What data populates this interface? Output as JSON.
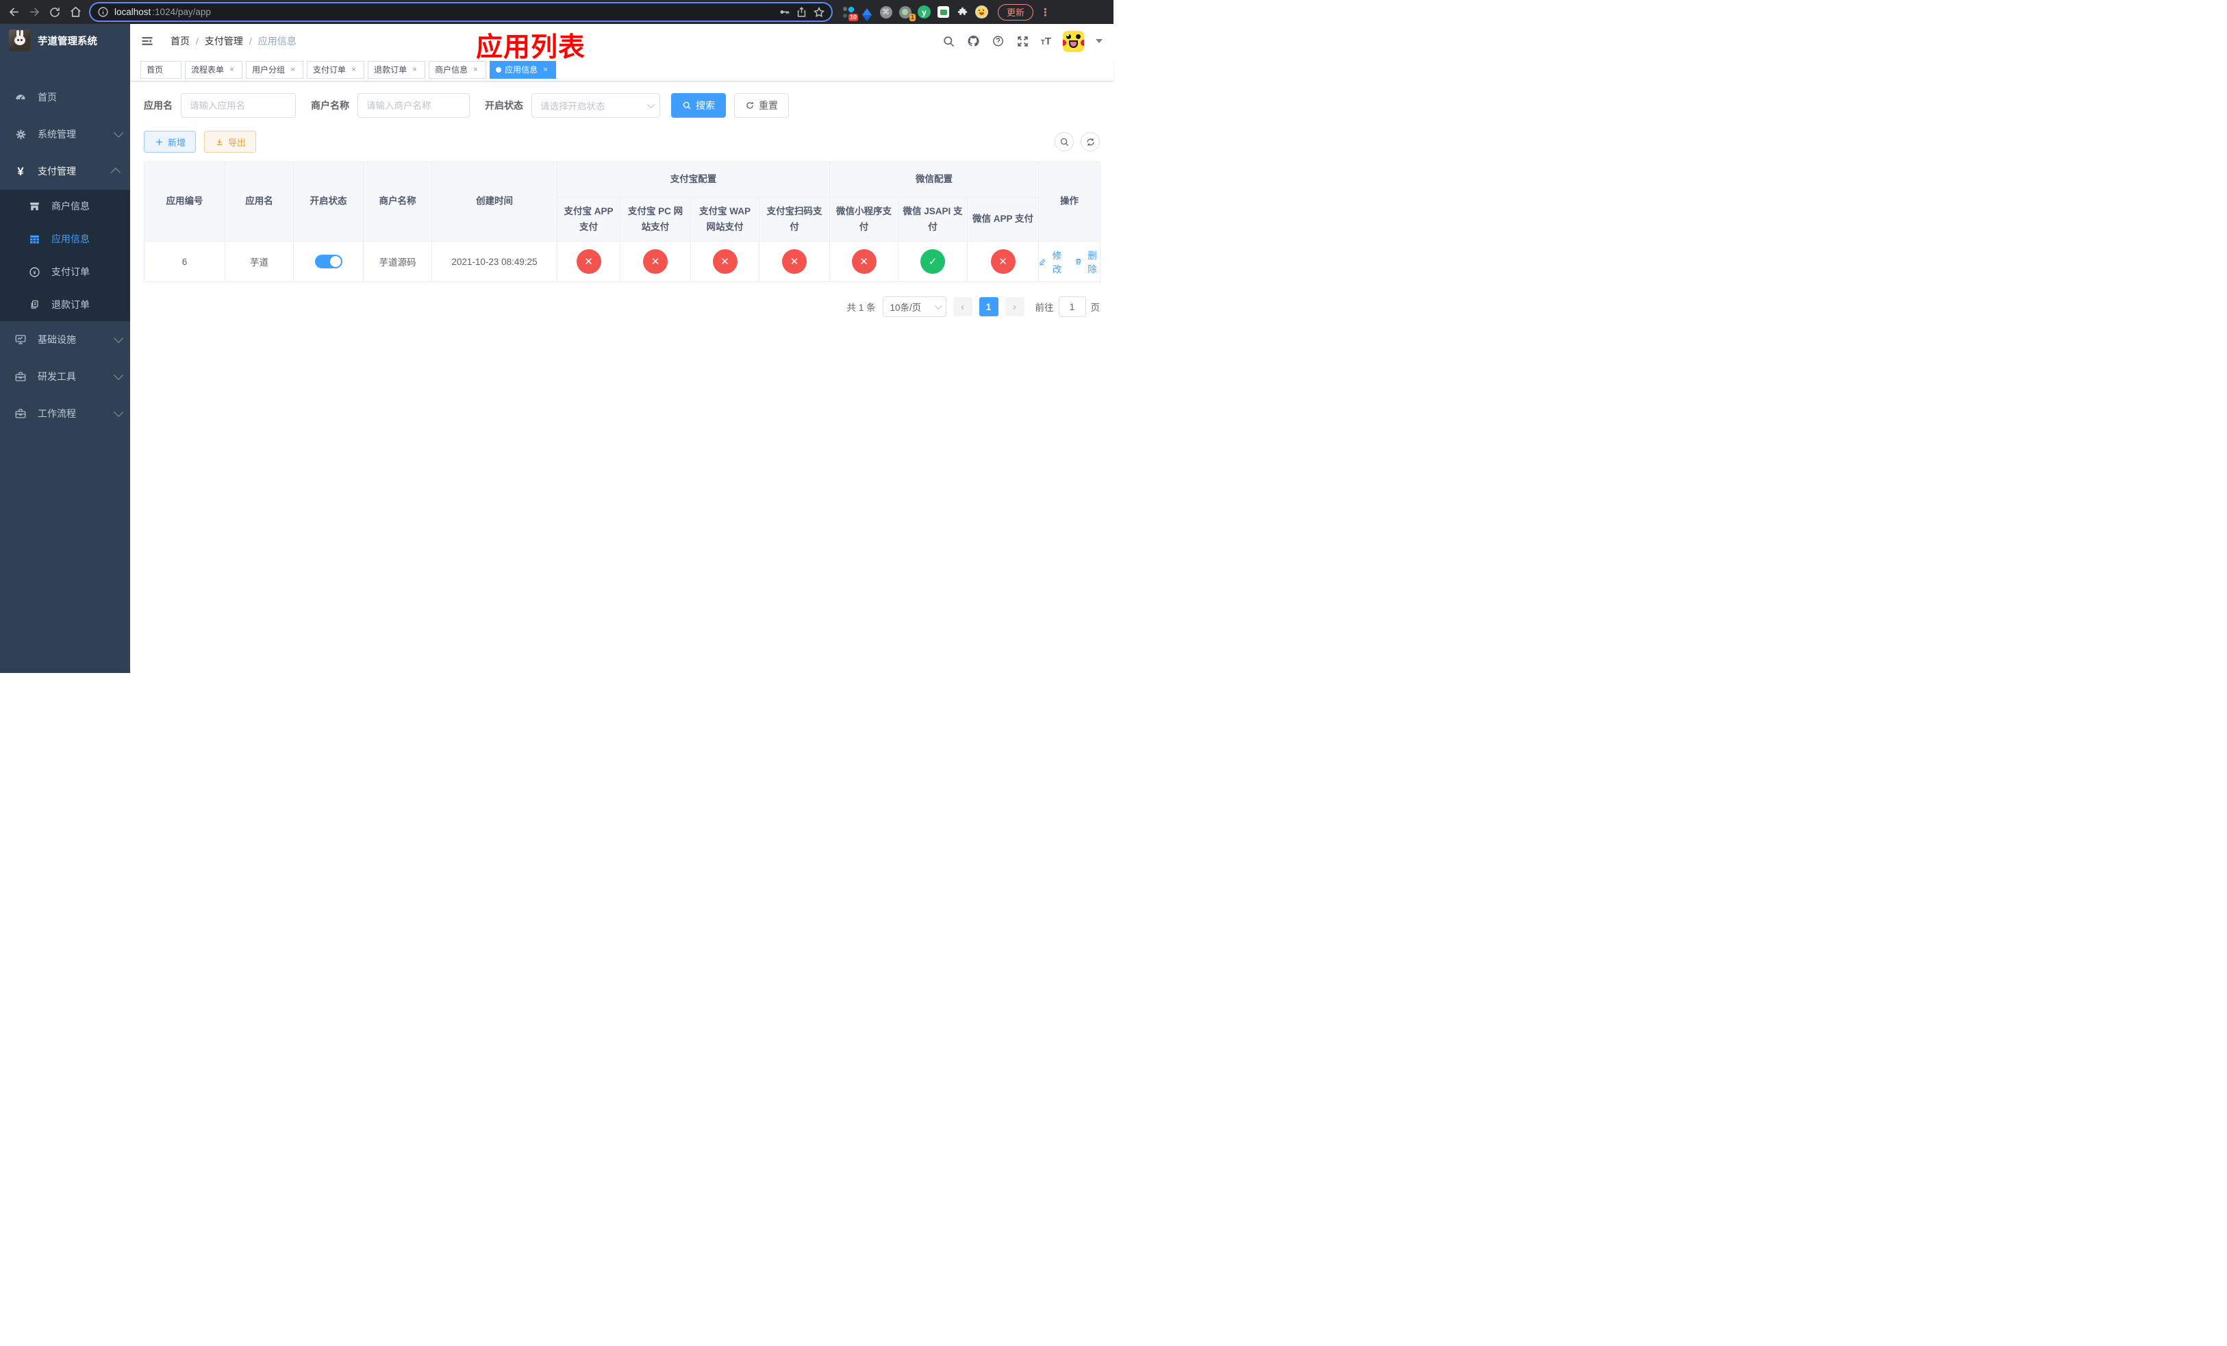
{
  "colors": {
    "accent": "#409eff",
    "danger": "#f5534d",
    "success": "#1ec06a",
    "annotation": "#fb0400"
  },
  "icons": {
    "check": "✓",
    "cross": "✕",
    "kebab": "⋮",
    "prev": "‹",
    "next": "›",
    "ext_y": "y",
    "ext_cmd": "⌘",
    "font_small": "T",
    "font_big": "T",
    "question": "?"
  },
  "browser": {
    "url_host": "localhost",
    "url_rest": ":1024/pay/app",
    "ext_badge_1": "10",
    "ext_badge_2": "1",
    "update_label": "更新"
  },
  "sidebar": {
    "title": "芋道管理系统",
    "items": [
      {
        "label": "首页"
      },
      {
        "label": "系统管理"
      },
      {
        "label": "支付管理"
      },
      {
        "label": "基础设施"
      },
      {
        "label": "研发工具"
      },
      {
        "label": "工作流程"
      }
    ],
    "submenu": [
      {
        "label": "商户信息"
      },
      {
        "label": "应用信息"
      },
      {
        "label": "支付订单"
      },
      {
        "label": "退款订单"
      }
    ]
  },
  "header": {
    "breadcrumb": [
      "首页",
      "支付管理",
      "应用信息"
    ],
    "separator": "/",
    "annotation": "应用列表"
  },
  "tabs": {
    "items": [
      {
        "label": "首页"
      },
      {
        "label": "流程表单",
        "close": "×"
      },
      {
        "label": "用户分组",
        "close": "×"
      },
      {
        "label": "支付订单",
        "close": "×"
      },
      {
        "label": "退款订单",
        "close": "×"
      },
      {
        "label": "商户信息",
        "close": "×"
      },
      {
        "label": "应用信息",
        "close": "×"
      }
    ]
  },
  "filters": {
    "app_name_label": "应用名",
    "app_name_placeholder": "请输入应用名",
    "merchant_label": "商户名称",
    "merchant_placeholder": "请输入商户名称",
    "status_label": "开启状态",
    "status_placeholder": "请选择开启状态",
    "search_label": "搜索",
    "reset_label": "重置"
  },
  "toolbar": {
    "add_label": "新增",
    "export_label": "导出"
  },
  "table": {
    "columns": [
      "应用编号",
      "应用名",
      "开启状态",
      "商户名称",
      "创建时间"
    ],
    "group_alipay": "支付宝配置",
    "group_wechat": "微信配置",
    "sub_columns": [
      "支付宝 APP 支付",
      "支付宝 PC 网站支付",
      "支付宝 WAP 网站支付",
      "支付宝扫码支付",
      "微信小程序支付",
      "微信 JSAPI 支付",
      "微信 APP 支付"
    ],
    "ops_column": "操作",
    "row": {
      "id": "6",
      "name": "芋道",
      "enabled": true,
      "merchant": "芋道源码",
      "created": "2021-10-23 08:49:25",
      "statuses": [
        "cross",
        "cross",
        "cross",
        "cross",
        "cross",
        "check",
        "cross"
      ],
      "edit_label": "修改",
      "delete_label": "删除"
    }
  },
  "pagination": {
    "total": "共 1 条",
    "page_size": "10条/页",
    "page": "1",
    "goto_label": "前往",
    "goto_value": "1",
    "unit": "页"
  }
}
